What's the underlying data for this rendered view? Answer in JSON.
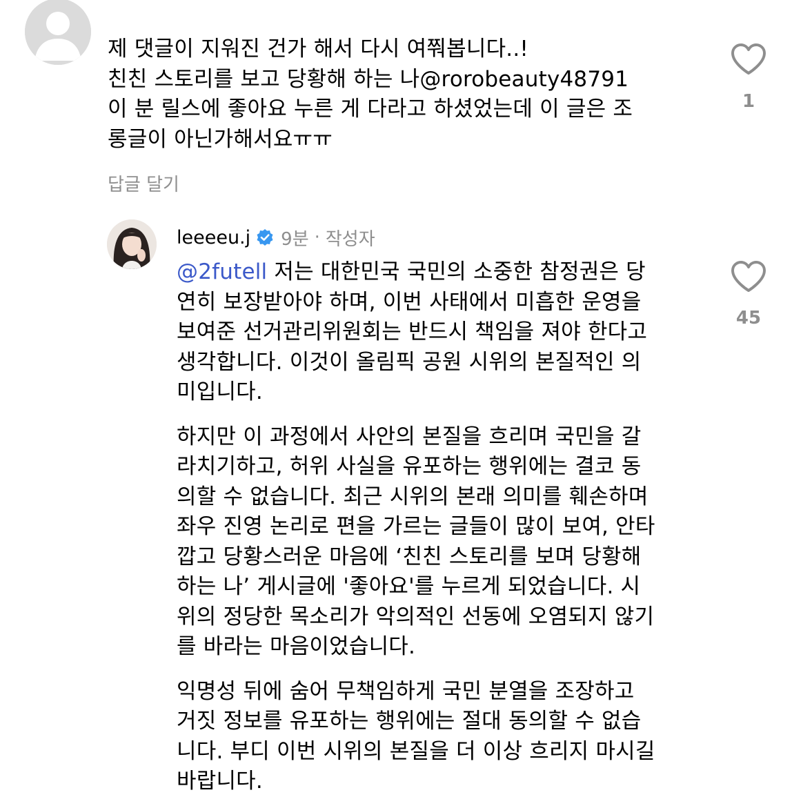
{
  "comments": [
    {
      "lines": [
        "제 댓글이 지워진 건가 해서 다시 여쭤봅니다..!",
        "친친 스토리를 보고 당황해 하는 나@rorobeauty48791",
        "이 분 릴스에 좋아요 누른 게 다라고 하셨었는데 이 글은 조",
        "롱글이 아닌가해서요ㅠㅠ"
      ],
      "reply_label": "답글 달기",
      "like_count": "1"
    },
    {
      "username": "leeeeu.j",
      "time": "9분",
      "separator": "·",
      "author_badge": "작성자",
      "mention": "@2futell",
      "paragraphs": [
        [
          " 저는 대한민국 국민의 소중한 참정권은 당",
          "연히 보장받아야 하며, 이번 사태에서 미흡한 운영을",
          "보여준 선거관리위원회는 반드시 책임을 져야 한다고",
          "생각합니다. 이것이 올림픽 공원 시위의 본질적인 의",
          "미입니다."
        ],
        [
          "하지만 이 과정에서 사안의 본질을 흐리며 국민을 갈",
          "라치기하고, 허위 사실을 유포하는 행위에는 결코 동",
          "의할 수 없습니다. 최근 시위의 본래 의미를 훼손하며",
          "좌우 진영 논리로 편을 가르는 글들이 많이 보여, 안타",
          "깝고 당황스러운 마음에 ‘친친 스토리를 보며 당황해",
          "하는 나’ 게시글에 '좋아요'를 누르게 되었습니다. 시",
          "위의 정당한 목소리가 악의적인 선동에 오염되지 않기",
          "를 바라는 마음이었습니다."
        ],
        [
          "익명성 뒤에 숨어 무책임하게 국민 분열을 조장하고",
          "거짓 정보를 유포하는 행위에는 절대 동의할 수 없습",
          "니다. 부디 이번 시위의 본질을 더 이상 흐리지 마시길",
          "바랍니다."
        ]
      ],
      "like_count": "45"
    }
  ],
  "colors": {
    "text": "#000000",
    "secondary": "#8e8e8e",
    "mention": "#3b59c9",
    "verified": "#3897f0"
  },
  "icons": [
    "default-avatar-icon",
    "profile-photo",
    "verified-badge-icon",
    "heart-outline-icon"
  ]
}
